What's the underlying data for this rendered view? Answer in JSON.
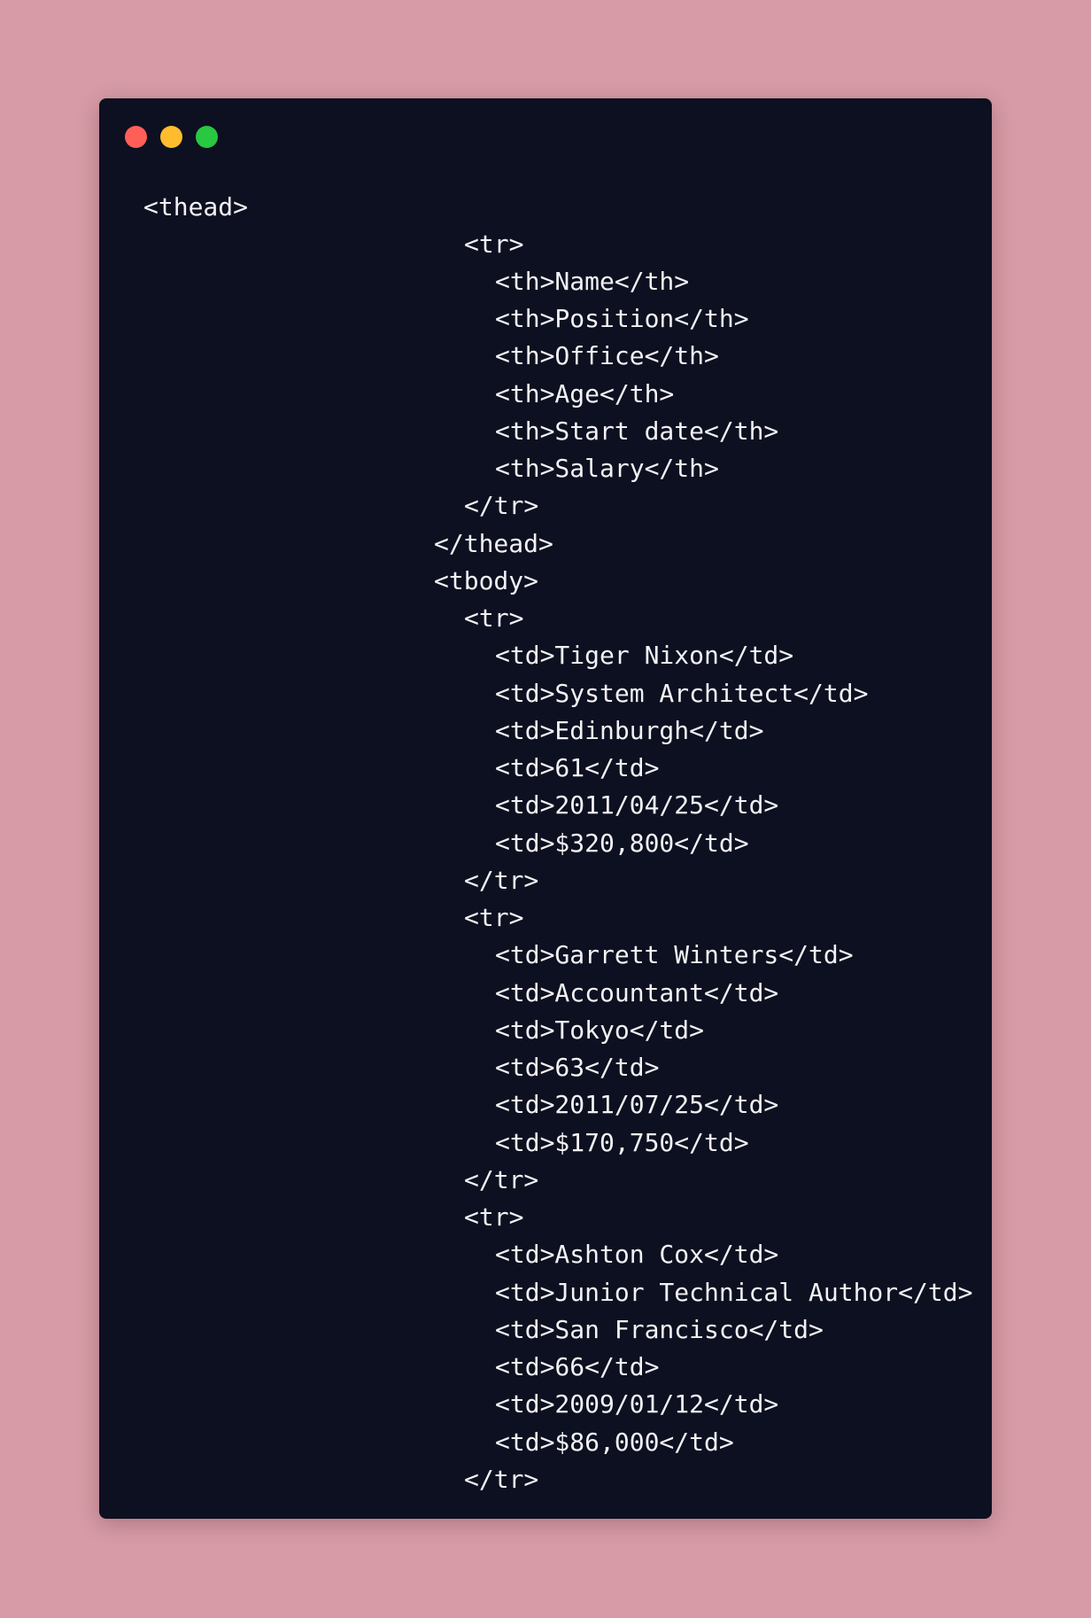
{
  "window": {
    "buttons": {
      "close": "close-button",
      "minimize": "minimize-button",
      "maximize": "maximize-button"
    },
    "colors": {
      "background": "#0d1020",
      "text": "#f2f2f5",
      "page_background": "#d69ba6",
      "close": "#ff5f57",
      "minimize": "#febc2e",
      "maximize": "#28c840"
    }
  },
  "code": {
    "lines": [
      "<thead>",
      "<tr>",
      "<th>Name</th>",
      "<th>Position</th>",
      "<th>Office</th>",
      "<th>Age</th>",
      "<th>Start date</th>",
      "<th>Salary</th>",
      "</tr>",
      "</thead>",
      "<tbody>",
      "<tr>",
      "<td>Tiger Nixon</td>",
      "<td>System Architect</td>",
      "<td>Edinburgh</td>",
      "<td>61</td>",
      "<td>2011/04/25</td>",
      "<td>$320,800</td>",
      "</tr>",
      "<tr>",
      "<td>Garrett Winters</td>",
      "<td>Accountant</td>",
      "<td>Tokyo</td>",
      "<td>63</td>",
      "<td>2011/07/25</td>",
      "<td>$170,750</td>",
      "</tr>",
      "<tr>",
      "<td>Ashton Cox</td>",
      "<td>Junior Technical Author</td>",
      "<td>San Francisco</td>",
      "<td>66</td>",
      "<td>2009/01/12</td>",
      "<td>$86,000</td>",
      "</tr>"
    ]
  }
}
